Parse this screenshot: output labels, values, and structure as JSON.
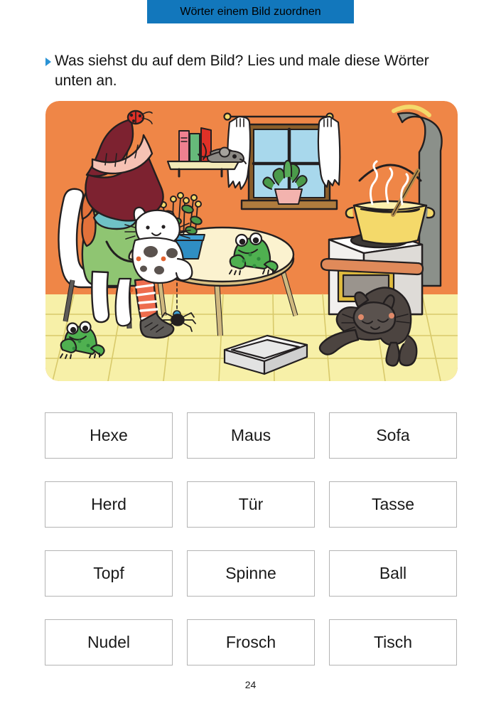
{
  "header": {
    "title": "Wörter einem Bild zuordnen",
    "background_color": "#1277bc",
    "text_color": "#ffffff"
  },
  "instruction": {
    "bullet_icon": "triangle-right-icon",
    "bullet_color": "#2a93d5",
    "text": "Was siehst du auf dem Bild? Lies und male diese Wörter unten an."
  },
  "illustration": {
    "name": "witch-kitchen-scene",
    "alt": "Hexe sitzt auf einem Stuhl mit Katze, Tisch mit Frosch, Fenster, Herd mit Topf und schwarze Katze",
    "colors": {
      "wall": "#ef8647",
      "floor": "#f7f0a8",
      "floor_line": "#d8c96a",
      "outline": "#231f20",
      "hat": "#7d2230",
      "hat_band": "#f6c2b4",
      "hair": "#e2713a",
      "dress": "#8fc572",
      "collar": "#6fc2c6",
      "stockings": "#ee6d4e",
      "shoes": "#5d5a57",
      "chair": "#ffffff",
      "table_top": "#fbf2cf",
      "table_rim": "#d9c082",
      "table_leg": "#d0b97f",
      "frog": "#4fb050",
      "frog_dark": "#2f8a3c",
      "mouse": "#8c8984",
      "cat_black": "#4c4440",
      "cat_white": "#ffffff",
      "cat_spots": "#5a524e",
      "cat_spots_orange": "#e2622f",
      "pot": "#f4d96a",
      "pot_soup": "#a8c86a",
      "stove": "#f2f0ee",
      "stove_door": "#9a948d",
      "stove_door_frame": "#e0bc3e",
      "pipe": "#8b908a",
      "window_frame": "#8b5e2a",
      "window_pane": "#a8d8ec",
      "curtain": "#ffffff",
      "shelf": "#f3e9b8",
      "book_pink": "#ef8090",
      "book_green": "#66b97a",
      "book_red": "#e03127",
      "plant_pot_blue": "#2f8ec4",
      "plant_pot_pink": "#f3b3ae",
      "plant_green": "#4a9a4a",
      "box_tray": "#f0f0f0",
      "spider": "#231f20",
      "ladybug": "#e03127"
    }
  },
  "word_grid": {
    "columns": 3,
    "words": [
      "Hexe",
      "Maus",
      "Sofa",
      "Herd",
      "Tür",
      "Tasse",
      "Topf",
      "Spinne",
      "Ball",
      "Nudel",
      "Frosch",
      "Tisch"
    ]
  },
  "footer": {
    "page_number": "24"
  }
}
